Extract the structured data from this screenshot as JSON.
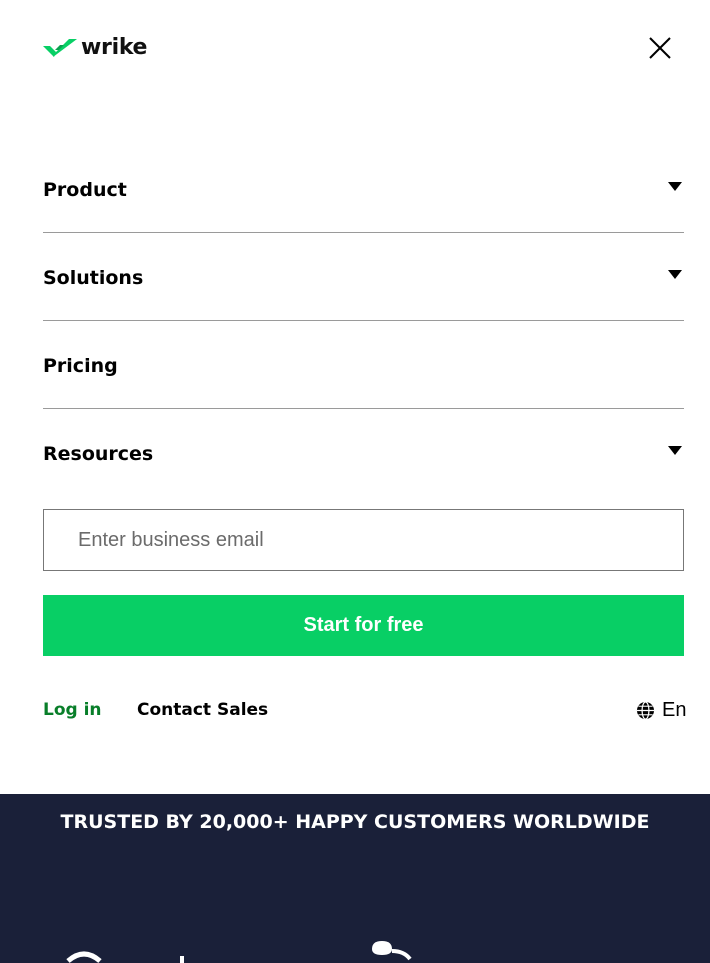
{
  "header": {
    "logo_text": "wrike",
    "brand_color": "#08cf65"
  },
  "menu": {
    "items": [
      {
        "label": "Product",
        "has_dropdown": true
      },
      {
        "label": "Solutions",
        "has_dropdown": true
      },
      {
        "label": "Pricing",
        "has_dropdown": false
      },
      {
        "label": "Resources",
        "has_dropdown": true
      }
    ]
  },
  "signup": {
    "email_placeholder": "Enter business email",
    "email_value": "",
    "start_label": "Start for free",
    "button_color": "#08cf65"
  },
  "footer_links": {
    "login_label": "Log in",
    "login_color": "#087e29",
    "contact_label": "Contact Sales",
    "language": "En",
    "language_icon": "globe-icon"
  },
  "trusted": {
    "title": "TRUSTED BY 20,000+ HAPPY CUSTOMERS WORLDWIDE",
    "background_color": "#1a2039"
  },
  "icons": {
    "close": "close-icon",
    "dropdown": "caret-down-icon",
    "logo": "wrike-checkmark-icon"
  }
}
